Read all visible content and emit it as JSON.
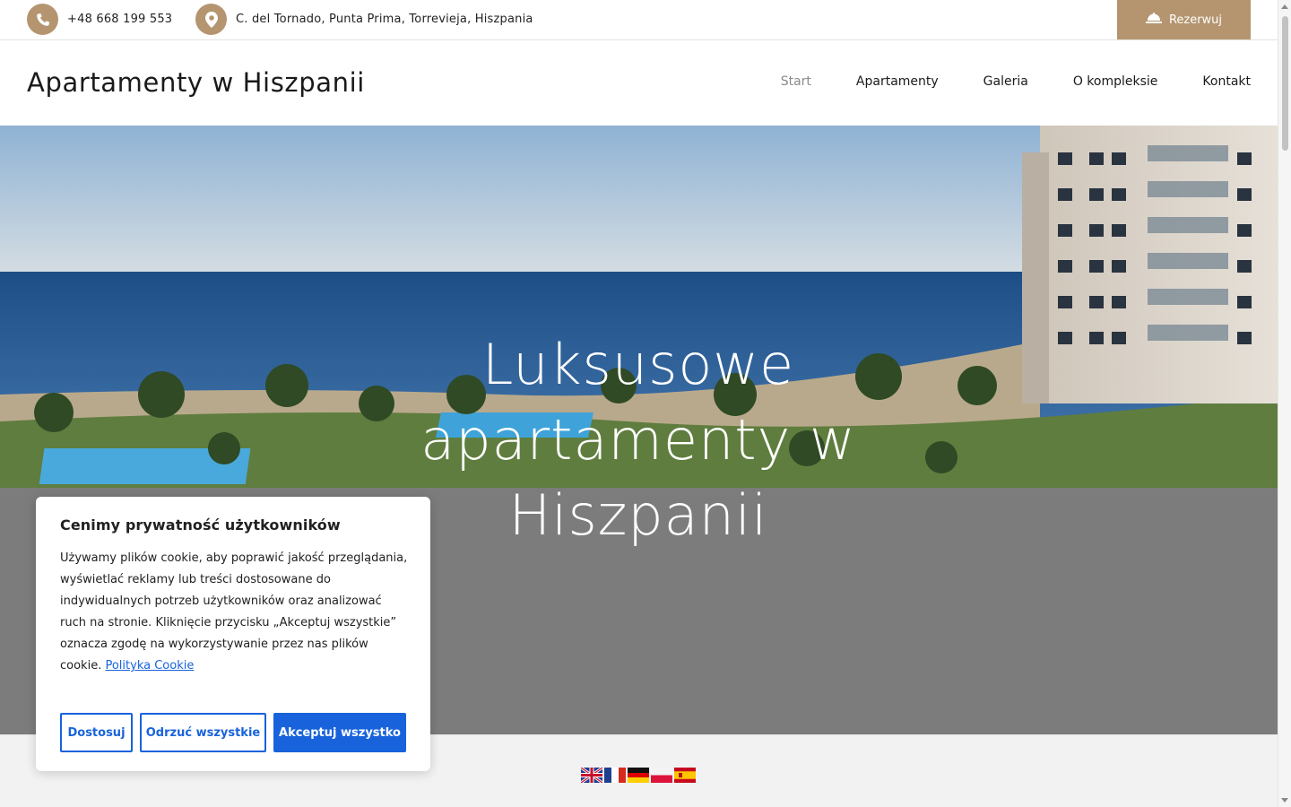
{
  "topbar": {
    "phone": "+48 668 199 553",
    "address": "C. del Tornado, Punta Prima, Torrevieja, Hiszpania",
    "reserve_label": "Rezerwuj"
  },
  "header": {
    "site_title": "Apartamenty w Hiszpanii",
    "nav": [
      {
        "label": "Start",
        "active": true
      },
      {
        "label": "Apartamenty"
      },
      {
        "label": "Galeria"
      },
      {
        "label": "O kompleksie"
      },
      {
        "label": "Kontakt"
      }
    ]
  },
  "hero": {
    "title_lines": [
      "Luksusowe",
      "apartamenty w",
      "Hiszpanii"
    ]
  },
  "cookie": {
    "title": "Cenimy prywatność użytkowników",
    "text": "Używamy plików cookie, aby poprawić jakość przeglądania, wyświetlać reklamy lub treści dostosowane do indywidualnych potrzeb użytkowników oraz analizować ruch na stronie. Kliknięcie przycisku „Akceptuj wszystkie” oznacza zgodę na wykorzystywanie przez nas plików cookie.",
    "link_label": "Polityka Cookie",
    "customize_label": "Dostosuj",
    "reject_label": "Odrzuć wszystkie",
    "accept_label": "Akceptuj wszystko"
  },
  "colors": {
    "accent": "#b4956f",
    "cookie_blue": "#1863dc",
    "grey_band": "#7c7c7c"
  },
  "icons": {
    "phone": "phone-icon",
    "location": "map-marker-icon",
    "reserve": "bell-icon"
  }
}
